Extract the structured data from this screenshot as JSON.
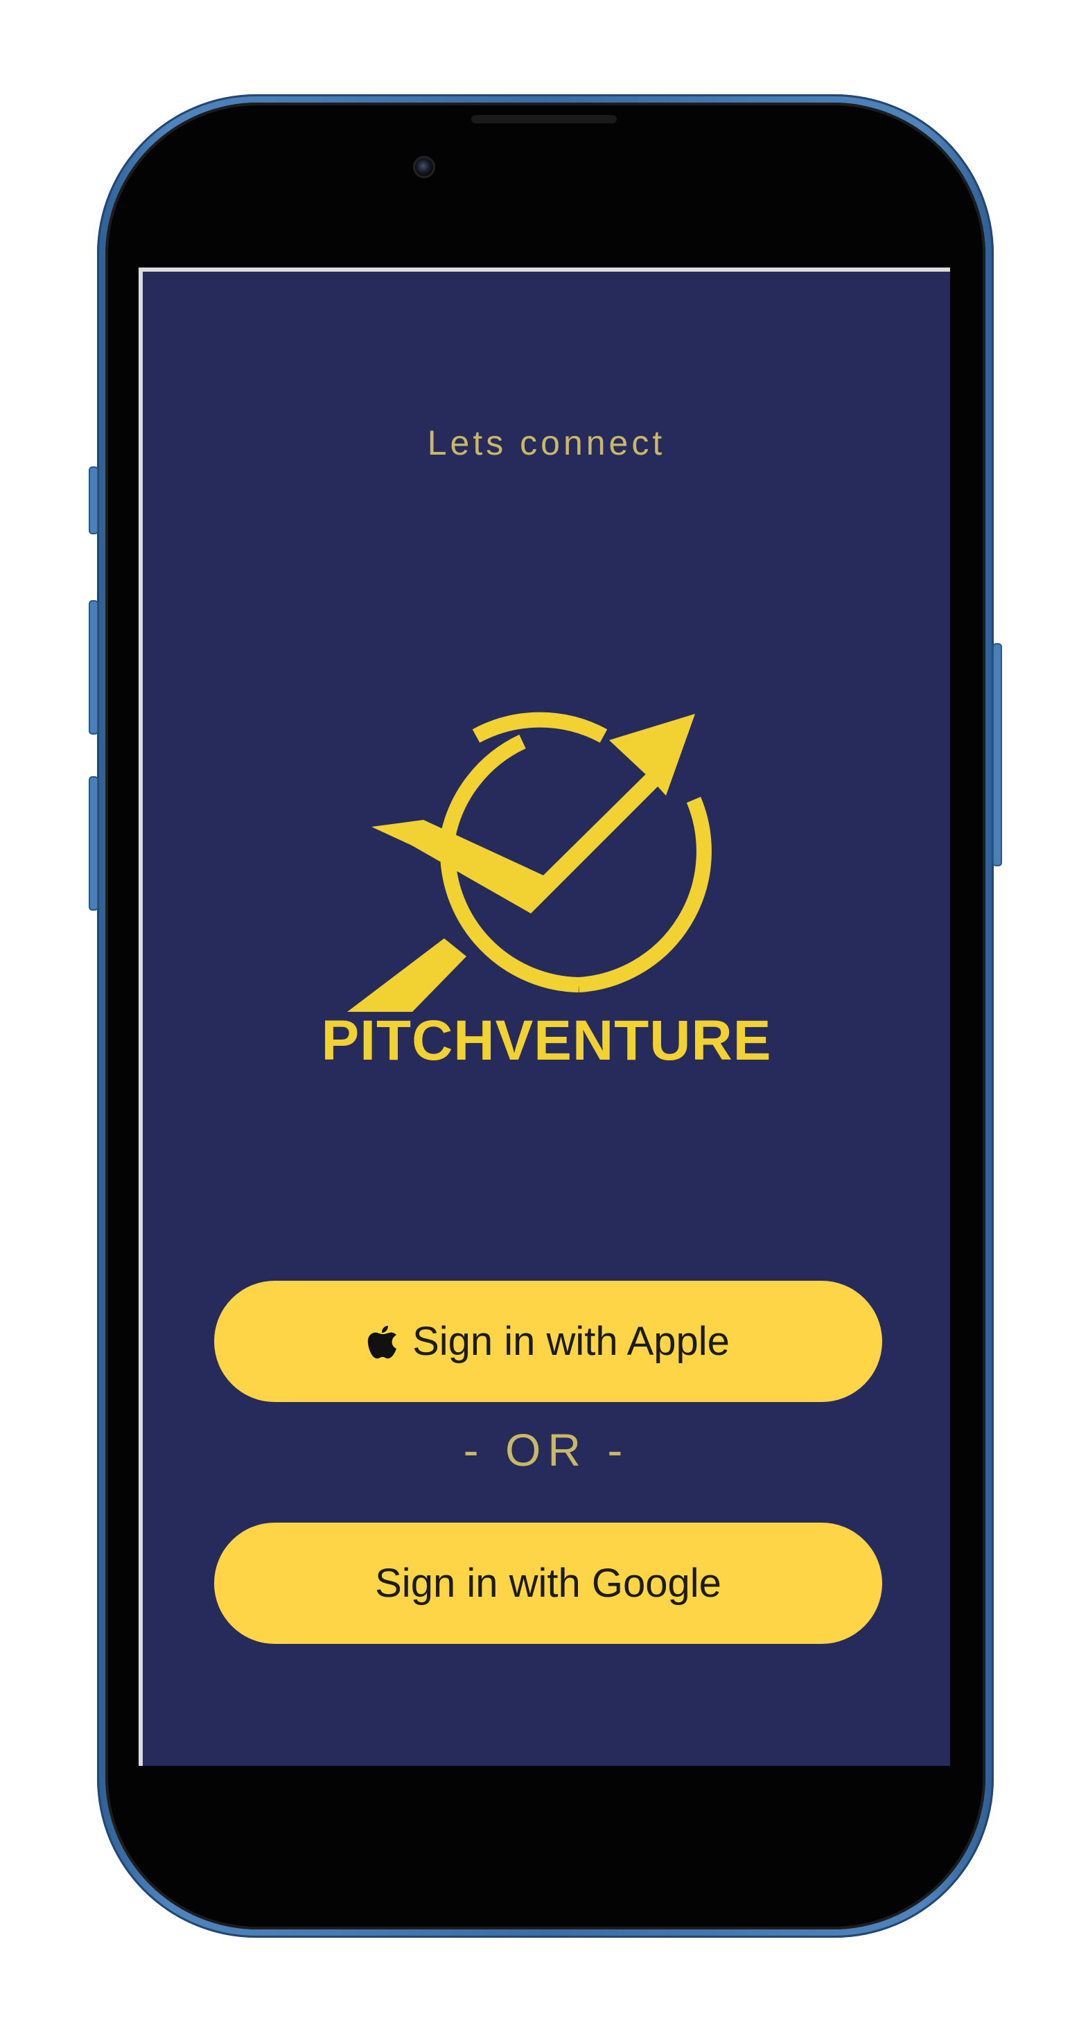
{
  "screen": {
    "title": "Lets connect",
    "brand_name": "PITCHVENTURE",
    "apple_button": {
      "label": "Sign in with Apple",
      "icon": "apple-icon"
    },
    "separator": "- OR -",
    "google_button": {
      "label": "Sign in with Google"
    }
  },
  "colors": {
    "background": "#272b5c",
    "accent": "#fdd547",
    "brand": "#f2d233",
    "muted_text": "#c8b867",
    "phone_frame": "#3a6da6"
  }
}
